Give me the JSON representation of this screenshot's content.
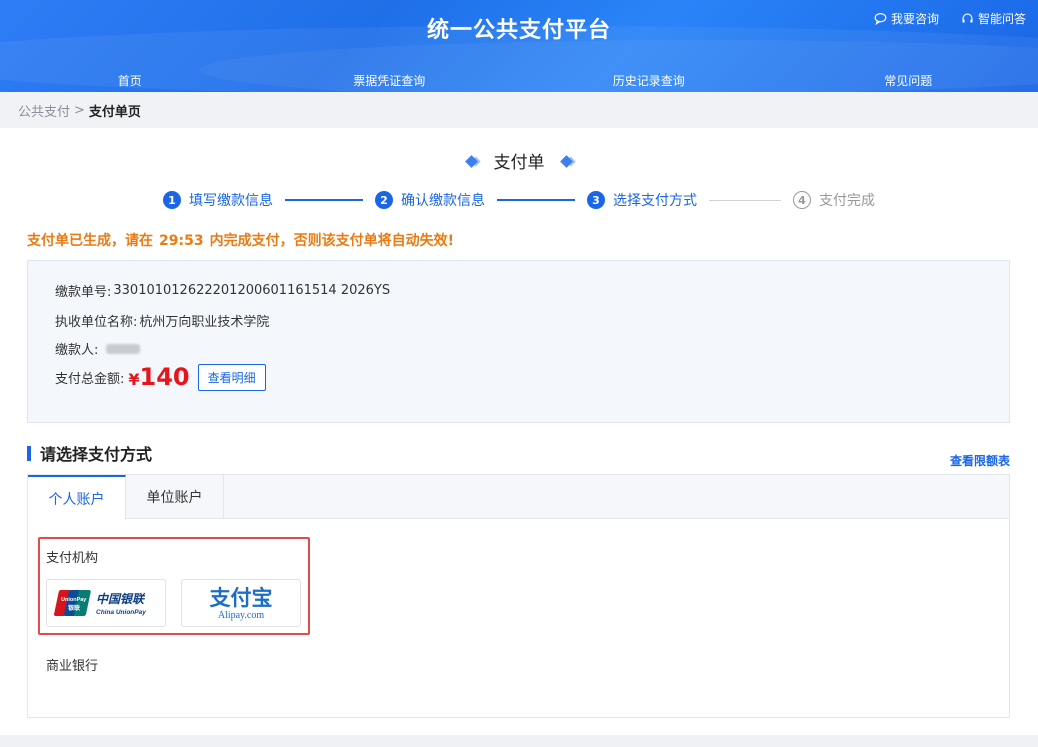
{
  "header": {
    "title": "统一公共支付平台",
    "links": [
      "我要咨询",
      "智能问答"
    ]
  },
  "nav": [
    "首页",
    "票据凭证查询",
    "历史记录查询",
    "常见问题"
  ],
  "breadcrumb": {
    "root": "公共支付",
    "separator": ">",
    "current": "支付单页"
  },
  "page_title": "支付单",
  "steps": [
    {
      "num": "1",
      "label": "填写缴款信息",
      "state": "done"
    },
    {
      "num": "2",
      "label": "确认缴款信息",
      "state": "done"
    },
    {
      "num": "3",
      "label": "选择支付方式",
      "state": "current"
    },
    {
      "num": "4",
      "label": "支付完成",
      "state": "pending"
    }
  ],
  "notice": {
    "prefix": "支付单已生成，请在",
    "countdown": "29:53",
    "suffix": "内完成支付，否则该支付单将自动失效!"
  },
  "order": {
    "number_label": "缴款单号:",
    "number": "330101012622201200601161514 2026YS",
    "unit_label": "执收单位名称:",
    "unit": "杭州万向职业技术学院",
    "payer_label": "缴款人:",
    "total_label": "支付总金额:",
    "currency": "¥",
    "amount": "140",
    "detail_button": "查看明细"
  },
  "payment": {
    "section_title": "请选择支付方式",
    "limit_link": "查看限额表",
    "tabs": [
      "个人账户",
      "单位账户"
    ],
    "org_label": "支付机构",
    "providers": [
      {
        "name": "中国银联",
        "sub": "China UnionPay",
        "badge": "UnionPay",
        "badge_sub": "银联"
      },
      {
        "name": "支付宝",
        "sub": "Alipay.com"
      }
    ],
    "commercial_label": "商业银行"
  },
  "colors": {
    "primary": "#1a66e6",
    "notice": "#ea7a12",
    "amount": "#e4161c",
    "highlight": "#e54b4b"
  }
}
